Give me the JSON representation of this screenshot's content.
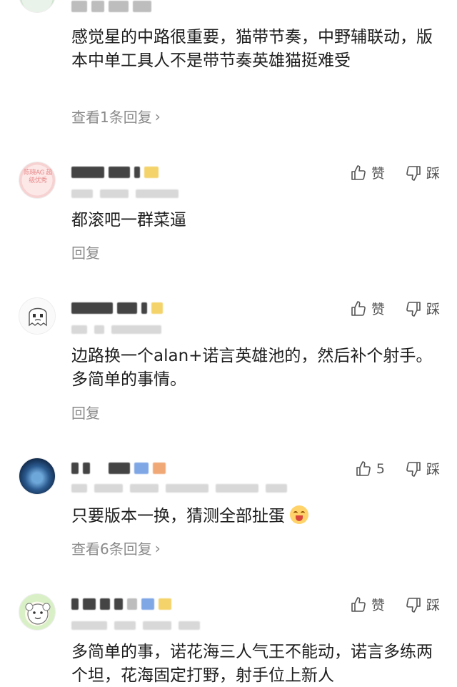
{
  "comments": [
    {
      "text": "感觉星的中路很重要，猫带节奏，中野辅联动，版本中单工具人不是带节奏英雄猫挺难受",
      "reply": "查看1条回复",
      "reply_chevron": "›"
    },
    {
      "like_label": "赞",
      "dislike_label": "踩",
      "avatar_text": "陈晓AG 超级优秀",
      "text": "都滚吧一群菜逼",
      "reply": "回复"
    },
    {
      "like_label": "赞",
      "dislike_label": "踩",
      "text": "边路换一个alan+诺言英雄池的，然后补个射手。多简单的事情。",
      "reply": "回复"
    },
    {
      "like_label": "5",
      "dislike_label": "踩",
      "text": "只要版本一换，猜测全部扯蛋",
      "reply": "查看6条回复",
      "reply_chevron": "›"
    },
    {
      "like_label": "赞",
      "dislike_label": "踩",
      "text": "多简单的事，诺花海三人气王不能动，诺言多练两个坦，花海固定打野，射手位上新人"
    }
  ],
  "icons": {
    "like": "thumbs-up-icon",
    "dislike": "thumbs-down-icon",
    "emoji": "grinning-emoji-icon"
  },
  "colors": {
    "text": "#1e1e1e",
    "muted": "#8a8a8a",
    "action": "#555555"
  }
}
